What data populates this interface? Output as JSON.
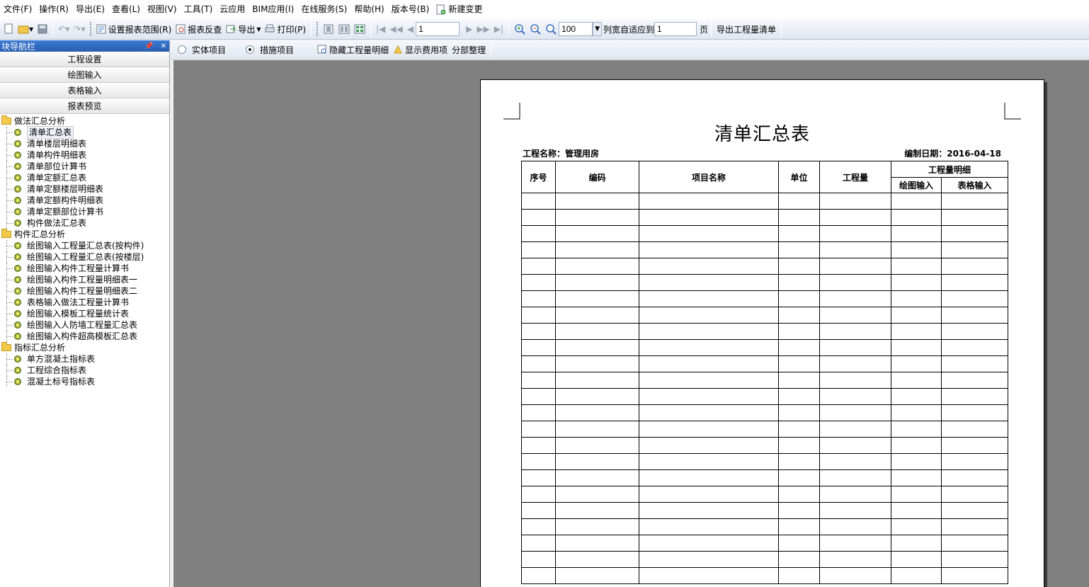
{
  "menu": {
    "items": [
      "文件(F)",
      "操作(R)",
      "导出(E)",
      "查看(L)",
      "视图(V)",
      "工具(T)",
      "云应用",
      "BIM应用(I)",
      "在线服务(S)",
      "帮助(H)",
      "版本号(B)"
    ],
    "new_change": "新建变更"
  },
  "toolbar": {
    "set_range": "设置报表范围(R)",
    "reverse_check": "报表反查",
    "export": "导出",
    "print": "打印(P)",
    "page_value": "1",
    "zoom_value": "100",
    "fit_label": "列宽自适应到",
    "fit_value": "1",
    "page_unit": "页",
    "export_list": "导出工程量清单"
  },
  "nav": {
    "title": "块导航栏",
    "buttons": [
      "工程设置",
      "绘图输入",
      "表格输入",
      "报表预览"
    ],
    "tree": [
      {
        "label": "做法汇总分析",
        "children": [
          "清单汇总表",
          "清单楼层明细表",
          "清单构件明细表",
          "清单部位计算书",
          "清单定额汇总表",
          "清单定额楼层明细表",
          "清单定额构件明细表",
          "清单定额部位计算书",
          "构件做法汇总表"
        ]
      },
      {
        "label": "构件汇总分析",
        "children": [
          "绘图输入工程量汇总表(按构件)",
          "绘图输入工程量汇总表(按楼层)",
          "绘图输入构件工程量计算书",
          "绘图输入构件工程量明细表一",
          "绘图输入构件工程量明细表二",
          "表格输入做法工程量计算书",
          "绘图输入模板工程量统计表",
          "绘图输入人防墙工程量汇总表",
          "绘图输入构件超高模板汇总表"
        ]
      },
      {
        "label": "指标汇总分析",
        "children": [
          "单方混凝土指标表",
          "工程综合指标表",
          "混凝土标号指标表"
        ]
      }
    ]
  },
  "options": {
    "entity": "实体项目",
    "measure": "措施项目",
    "hide_detail": "隐藏工程量明细",
    "show_fee": "显示费用项",
    "partial": "分部整理"
  },
  "report": {
    "title": "清单汇总表",
    "project": "工程名称：管理用房",
    "date": "编制日期：2016-04-18",
    "headers": {
      "seq": "序号",
      "code": "编码",
      "name": "项目名称",
      "unit": "单位",
      "qty": "工程量",
      "detail": "工程量明细",
      "draw": "绘图输入",
      "table": "表格输入"
    }
  },
  "colors": {
    "accent": "#2a5db0",
    "preview_bg": "#808080"
  }
}
